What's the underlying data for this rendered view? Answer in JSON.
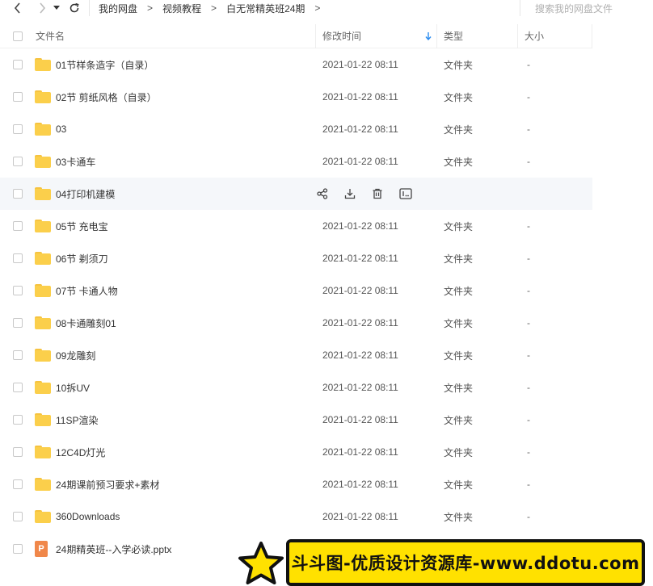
{
  "nav": {
    "breadcrumbs": [
      "我的网盘",
      "视频教程",
      "白无常精英班24期"
    ],
    "crumb_separator": ">",
    "search_placeholder": "搜索我的网盘文件"
  },
  "header": {
    "name": "文件名",
    "modified": "修改时间",
    "type": "类型",
    "size": "大小"
  },
  "rows": [
    {
      "name": "01节样条造字（自录）",
      "time": "2021-01-22 08:11",
      "type": "文件夹",
      "size": "-",
      "icon": "folder-icon"
    },
    {
      "name": "02节 剪纸风格（自录）",
      "time": "2021-01-22 08:11",
      "type": "文件夹",
      "size": "-",
      "icon": "folder-icon"
    },
    {
      "name": "03",
      "time": "2021-01-22 08:11",
      "type": "文件夹",
      "size": "-",
      "icon": "folder-icon"
    },
    {
      "name": "03卡通车",
      "time": "2021-01-22 08:11",
      "type": "文件夹",
      "size": "-",
      "icon": "folder-icon"
    },
    {
      "name": "04打印机建模",
      "time": "",
      "type": "",
      "size": "",
      "icon": "folder-icon",
      "hover": true
    },
    {
      "name": "05节 充电宝",
      "time": "2021-01-22 08:11",
      "type": "文件夹",
      "size": "-",
      "icon": "folder-icon"
    },
    {
      "name": "06节 剃须刀",
      "time": "2021-01-22 08:11",
      "type": "文件夹",
      "size": "-",
      "icon": "folder-icon"
    },
    {
      "name": "07节 卡通人物",
      "time": "2021-01-22 08:11",
      "type": "文件夹",
      "size": "-",
      "icon": "folder-icon"
    },
    {
      "name": "08卡通雕刻01",
      "time": "2021-01-22 08:11",
      "type": "文件夹",
      "size": "-",
      "icon": "folder-icon"
    },
    {
      "name": "09龙雕刻",
      "time": "2021-01-22 08:11",
      "type": "文件夹",
      "size": "-",
      "icon": "folder-icon"
    },
    {
      "name": "10拆UV",
      "time": "2021-01-22 08:11",
      "type": "文件夹",
      "size": "-",
      "icon": "folder-icon"
    },
    {
      "name": "11SP渲染",
      "time": "2021-01-22 08:11",
      "type": "文件夹",
      "size": "-",
      "icon": "folder-icon"
    },
    {
      "name": "12C4D灯光",
      "time": "2021-01-22 08:11",
      "type": "文件夹",
      "size": "-",
      "icon": "folder-icon"
    },
    {
      "name": "24期课前预习要求+素材",
      "time": "2021-01-22 08:11",
      "type": "文件夹",
      "size": "-",
      "icon": "folder-icon"
    },
    {
      "name": "360Downloads",
      "time": "2021-01-22 08:11",
      "type": "文件夹",
      "size": "-",
      "icon": "folder-icon"
    },
    {
      "name": "24期精英班--入学必读.pptx",
      "time": "",
      "type": "",
      "size": "",
      "icon": "pptx-icon"
    }
  ],
  "ppt_letter": "P",
  "row_actions": [
    "share-icon",
    "download-icon",
    "delete-icon",
    "more-icon"
  ],
  "watermark": {
    "text": "斗斗图-优质设计资源库-www.ddotu.com"
  },
  "colors": {
    "accent": "#2b8cf0",
    "folder": "#fbcf4b",
    "pptx": "#f0874a",
    "banner": "#ffe100"
  }
}
